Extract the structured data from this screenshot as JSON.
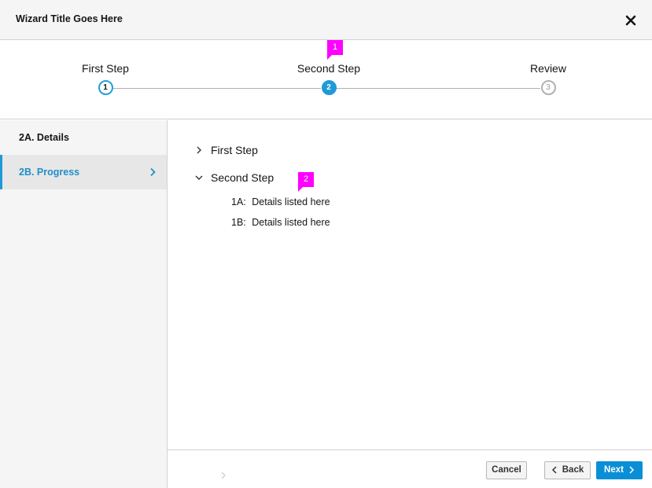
{
  "header": {
    "title": "Wizard Title Goes Here",
    "close_icon": "close-icon"
  },
  "steps": [
    {
      "label": "First Step",
      "number": "1",
      "state": "done"
    },
    {
      "label": "Second Step",
      "number": "2",
      "state": "current"
    },
    {
      "label": "Review",
      "number": "3",
      "state": "future"
    }
  ],
  "markers": [
    "1",
    "2"
  ],
  "sidebar": {
    "items": [
      {
        "label": "2A. Details",
        "active": false
      },
      {
        "label": "2B. Progress",
        "active": true
      }
    ]
  },
  "main": {
    "tree": [
      {
        "label": "First Step",
        "expanded": false
      },
      {
        "label": "Second Step",
        "expanded": true
      }
    ],
    "details": [
      {
        "prefix": "1A:",
        "text": "Details listed here"
      },
      {
        "prefix": "1B:",
        "text": "Details listed here"
      }
    ]
  },
  "footer": {
    "cancel_label": "Cancel",
    "back_label": "Back",
    "next_label": "Next"
  },
  "colors": {
    "accent": "#1f9ad6",
    "marker": "#ff00ff",
    "primary_button": "#0a8fd6"
  }
}
